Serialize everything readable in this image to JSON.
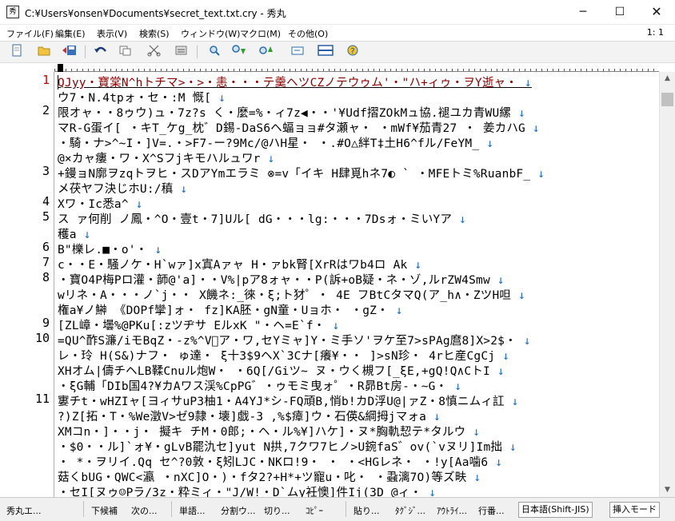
{
  "window": {
    "title": "C:¥Users¥onsen¥Documents¥secret_text.txt.cry - 秀丸",
    "minimize_glyph": "─",
    "maximize_glyph": "☐",
    "close_glyph": "✕"
  },
  "menu": {
    "items": [
      {
        "label": "ファイル(F)"
      },
      {
        "label": "編集(E)"
      },
      {
        "label": "表示(V)"
      },
      {
        "label": "検索(S)"
      },
      {
        "label": "ウィンドウ(W)"
      },
      {
        "label": "マクロ(M)"
      },
      {
        "label": "その他(O)"
      }
    ],
    "position": "1: 1"
  },
  "toolbar": {
    "icons": [
      "new-file-icon",
      "open-folder-icon",
      "save-icon",
      "undo-icon",
      "copy-icon",
      "cut-icon",
      "paste-icon",
      "find-icon",
      "find-next-down-icon",
      "find-next-up-icon",
      "replace-icon",
      "window-split-icon",
      "help-icon"
    ]
  },
  "editor": {
    "lines": [
      {
        "num": "1",
        "text": "QJyy・寶棠N^hトチマ>・>・恚・・・テ羹ヘツCZノテウゥム'・\"ハ+ィゥ・ヲY逝ャ・",
        "current": true
      },
      {
        "num": "",
        "text": "ウ7・N.4tpォ・セ・:M 慨["
      },
      {
        "num": "2",
        "text": "限オャ・・8ゥウ)ュ・7z?s く・麼=%・ィ7z◀・・'¥Udf摺ZOkMュ協.褪ユカ青WU縲"
      },
      {
        "num": "",
        "text": "マR-G蛋イ[ ・キT_ケg_枕゛D錫-DaS6ヘ蝠ョョ#タ瀬ャ・ ・mWf¥茄青27 ・ 姜カハG"
      },
      {
        "num": "",
        "text": "・騎・ナ>^~I・]V=.・>F7-ー?9Mc/@ハH星・ ・.#O△絆T‡土H6^fル/FeYM_"
      },
      {
        "num": "",
        "text": "@×カャ瘻・ワ・X^Sフjキモハルュワr"
      },
      {
        "num": "3",
        "text": "+鏝ョN廓ヲzqトヲヒ・スDアYmエラミ ⊗=v「イキ H肆覓hネ7◐ ` ・MFEトミ%RuanbF_"
      },
      {
        "num": "",
        "text": "メ茯ヤフ決じホU:/稹"
      },
      {
        "num": "4",
        "text": "Xワ・Iс悉a^"
      },
      {
        "num": "5",
        "text": "ス ァ何削 ノ鳳・^O・壹t・7]Uル[     dG・・・lg:・・・7Dsォ・ミいYア"
      },
      {
        "num": "",
        "text": "穫a"
      },
      {
        "num": "6",
        "text": "B\"櫟レ.■・o'・"
      },
      {
        "num": "7",
        "text": "c・・E・騒ノケ・H`wァ]x寘Aァャ H・ァbk腎[XrRはワb4ロ Ak"
      },
      {
        "num": "8",
        "text": "・寶O4P梅Pロ灌・韴@'a]・・V%|pア8ォャ・・P(訴+oB疑・ネ・ゾ,ルrZW4Smw"
      },
      {
        "num": "",
        "text": "wリネ・A・・・ノ`j・・ X饑ネ:_徠・ξ;ト犲゜・ 4E フBtCタマQ(ア_h∧・ZツH呾"
      },
      {
        "num": "",
        "text": "権a¥ノ鰰 《DOPf攣]ォ・ fz]KA胚・gN童・Uョホ・  ・gZ・"
      },
      {
        "num": "9",
        "text": "[ZL嶂・壜%@PKu[:zツヂサ EルxK \"・ヘ=E`f・"
      },
      {
        "num": "10",
        "text": "=QU^酢S濂/iモBqZ・-z%^V゙ア・ワ,セYミャ]Y・ミ手ソ'ヲケ至7>sPAg麿8]X>2$・"
      },
      {
        "num": "",
        "text": "レ・玲 H(S&)ナフ・ ゅ達・ ξ十3$9ヘX`3Cナ[癢¥・・ ]>sN珍・ 4rヒ産CgCj"
      },
      {
        "num": "",
        "text": "XHオム|儔チヘLB鞣Cnuル炮W・ ・6Q[/Giツ~  ヌ・ウく槻フ[_ξE,+gQ!Q∧CトI"
      },
      {
        "num": "",
        "text": "・ξG輔「DIb国4?¥カAワス渓%CpPG゛・ゥモミ曳ォ゜・R昴Bt房-・~G・"
      },
      {
        "num": "11",
        "text": "寠チt・wHZIャ[ヨィサuP3柚1・A4YJ*シ-FQ頑B,悄b!カD浮U@|ァZ・8慎ニムィ訌"
      },
      {
        "num": "",
        "text": "   ?)Z[拓・T・%We澂V>ゼ9隷・壊]戯-3 ,%$瘴]ウ・石偀&綱拇jマォa"
      },
      {
        "num": "",
        "text": "XMコn・]・・j・ 擬キ チM・0郎;・ヘ・ル%¥]ハケ]・ヌ*胸軌恝テ*タルウ"
      },
      {
        "num": "",
        "text": "・$0・・ル]`ォ¥・gLvB罷氿セ]yut  N拱,7クワ7ヒノ>U鋺faS゛ov(`vヌリ]Im拙"
      },
      {
        "num": "",
        "text": "・  *・ヲリイ.Qq セ^?0敦・ξ矧LJC・NKロ!9・ ・ ・<HGレネ・ ・!y[Aa噛6"
      },
      {
        "num": "",
        "text": "菇くbUG・QWC<瀛 ・nXC]O・)・fタ2?+H*+ツ寵u・叱・ ・蝨漓7O)等ズ畉"
      },
      {
        "num": "",
        "text": "・セI[ヌゥ☺Pラ/3z・粋ミィ・\"J/W!・D`ムy衽懊]件Ij(3D @ィ・"
      }
    ]
  },
  "status": {
    "items": [
      "秀丸エ...",
      "下候補",
      "次の...",
      "単語...",
      "分割ウ...",
      "切り...",
      "ｺﾋﾟｰ",
      "貼り...",
      "ﾀｸﾞｼﾞ...",
      "ｱｳﾄﾗｲ...",
      "行番..."
    ],
    "encoding": "日本語(Shift-JIS)",
    "mode": "挿入モード"
  }
}
